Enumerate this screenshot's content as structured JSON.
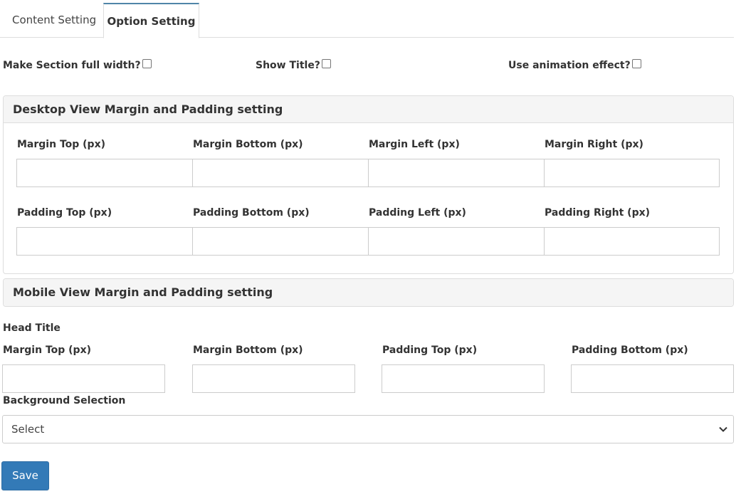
{
  "tabs": [
    {
      "label": "Content Setting",
      "active": false
    },
    {
      "label": "Option Setting",
      "active": true
    }
  ],
  "options": {
    "full_width": {
      "label": "Make Section full width?",
      "checked": false
    },
    "show_title": {
      "label": "Show Title?",
      "checked": false
    },
    "animation": {
      "label": "Use animation effect?",
      "checked": false
    }
  },
  "desktop": {
    "title": "Desktop View Margin and Padding setting",
    "margin_fields": [
      {
        "label": "Margin Top (px)",
        "value": ""
      },
      {
        "label": "Margin Bottom (px)",
        "value": ""
      },
      {
        "label": "Margin Left (px)",
        "value": ""
      },
      {
        "label": "Margin Right (px)",
        "value": ""
      }
    ],
    "padding_fields": [
      {
        "label": "Padding Top (px)",
        "value": ""
      },
      {
        "label": "Padding Bottom (px)",
        "value": ""
      },
      {
        "label": "Padding Left (px)",
        "value": ""
      },
      {
        "label": "Padding Right (px)",
        "value": ""
      }
    ]
  },
  "mobile": {
    "title": "Mobile View Margin and Padding setting"
  },
  "head_title": {
    "heading": "Head Title",
    "fields": [
      {
        "label": "Margin Top (px)",
        "value": ""
      },
      {
        "label": "Margin Bottom (px)",
        "value": ""
      },
      {
        "label": "Padding Top (px)",
        "value": ""
      },
      {
        "label": "Padding Bottom (px)",
        "value": ""
      }
    ]
  },
  "background": {
    "label": "Background Selection",
    "selected": "Select"
  },
  "save_label": "Save",
  "colors": {
    "accent": "#337ab7",
    "active_tab_border": "#4f85a8",
    "panel_header_bg": "#f5f5f5"
  }
}
